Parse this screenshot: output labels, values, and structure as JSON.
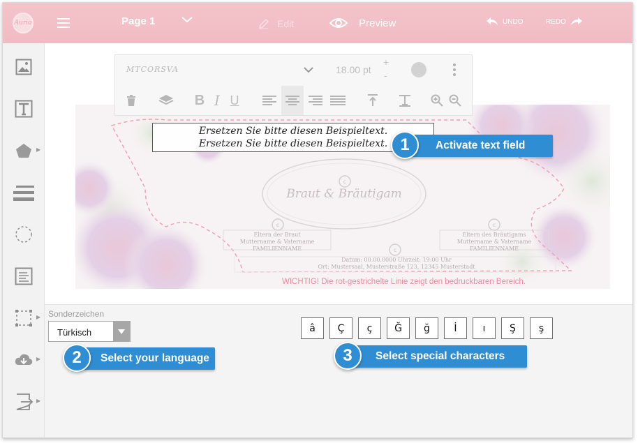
{
  "topbar": {
    "logo_text": "Aurio",
    "page_label": "Page 1",
    "edit_label": "Edit",
    "preview_label": "Preview",
    "undo_label": "UNDO",
    "redo_label": "REDO"
  },
  "sidebar": {
    "items": [
      {
        "icon": "image-icon",
        "has_submenu": false
      },
      {
        "icon": "text-icon",
        "has_submenu": false
      },
      {
        "icon": "shape-icon",
        "has_submenu": true
      },
      {
        "icon": "lines-icon",
        "has_submenu": false
      },
      {
        "icon": "circle-frame-icon",
        "has_submenu": false
      },
      {
        "icon": "text-align-icon",
        "has_submenu": false
      },
      {
        "icon": "selection-frame-icon",
        "has_submenu": true
      },
      {
        "icon": "cloud-download-icon",
        "has_submenu": true
      },
      {
        "icon": "exit-icon",
        "has_submenu": true
      }
    ]
  },
  "text_toolbar": {
    "font_name": "MTCORSVA",
    "font_size": "18.00",
    "font_unit": "pt",
    "size_plus": "+",
    "size_minus": "-",
    "color": "#d2d2d2",
    "bold_label": "B",
    "italic_label": "I",
    "underline_label": "U",
    "active_align": "center"
  },
  "card": {
    "text_lines": [
      "Ersetzen Sie bitte diesen Beispieltext.",
      "Ersetzen Sie bitte diesen Beispieltext."
    ],
    "couple_title": "Braut & Bräutigam",
    "bride_parents": [
      "Eltern der Braut",
      "Muttername & Vatername",
      "FAMILIENNAME"
    ],
    "groom_parents": [
      "Eltern des Bräutigams",
      "Muttername & Vatername",
      "FAMILIENNAME"
    ],
    "event_lines": [
      "Datum: 00.00.0000 Uhrzeit: 19:00 Uhr",
      "Ort: Mustersaal, Musterstraße 123, 12345 Musterstadt"
    ],
    "warning": "WICHTIG!  Die rot-gestrichelte Linie zeigt den bedruckbaren Bereich.",
    "copyright_mark": "c"
  },
  "callouts": {
    "c1": {
      "num": "1",
      "label": "Activate text field"
    },
    "c2": {
      "num": "2",
      "label": "Select your language"
    },
    "c3": {
      "num": "3",
      "label": "Select special characters"
    }
  },
  "special_chars": {
    "label": "Sonderzeichen",
    "language": "Türkisch",
    "chars": [
      "â",
      "Ç",
      "ç",
      "Ğ",
      "ğ",
      "İ",
      "ı",
      "Ş",
      "ş"
    ]
  },
  "colors": {
    "topbar": "#f0bcc3",
    "callout": "#2f8ed3",
    "warning": "#f08aa0",
    "dashed_line": "#f0a0b4"
  }
}
